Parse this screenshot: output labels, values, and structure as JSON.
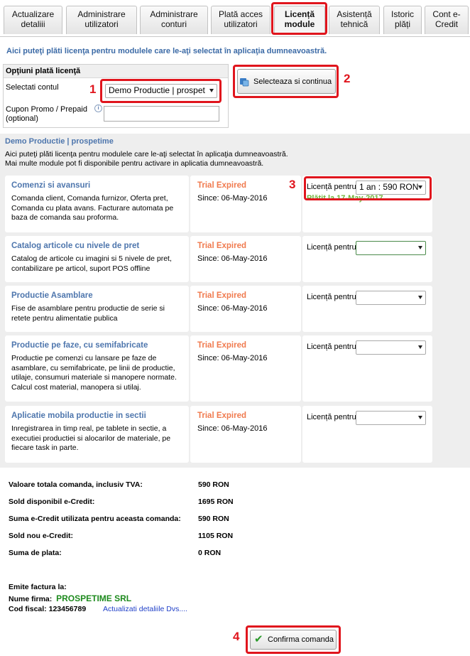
{
  "tabs": [
    {
      "label": "Actualizare detaliii",
      "active": false
    },
    {
      "label": "Administrare utilizatori",
      "active": false
    },
    {
      "label": "Administrare conturi",
      "active": false
    },
    {
      "label": "Plată acces utilizatori",
      "active": false
    },
    {
      "label": "Licență module",
      "active": true
    },
    {
      "label": "Asistență tehnică",
      "active": false
    },
    {
      "label": "Istoric plăți",
      "active": false
    },
    {
      "label": "Cont e-Credit",
      "active": false
    }
  ],
  "intro": "Aici puteţi plăti licenţa pentru modulele care le-aţi selectat în aplicaţia dumneavoastră.",
  "options": {
    "title": "Opţiuni plată licenţă",
    "account_label": "Selectati contul",
    "account_value": "Demo Productie | prospet",
    "coupon_label": "Cupon Promo / Prepaid (optional)",
    "coupon_value": "",
    "select_button": "Selecteaza si continua"
  },
  "steps": [
    "1",
    "2",
    "3",
    "4"
  ],
  "account_section": {
    "title": "Demo Productie | prospetime",
    "desc1": "Aici puteţi plăti licenţa pentru modulele care le-aţi selectat în aplicaţia dumneavoastră.",
    "desc2": "Mai multe module pot fi disponibile pentru activare in aplicatia dumneavoastră."
  },
  "modules": [
    {
      "title": "Comenzi si avansuri",
      "desc": "Comanda client, Comanda furnizor, Oferta pret, Comanda cu plata avans. Facturare automata pe baza de comanda sau proforma.",
      "status": "Trial Expired",
      "since": "Since: 06-May-2016",
      "license_label": "Licență pentru",
      "license_value": "1 an : 590 RON",
      "paid_until": "Plătit la 17-May-2017"
    },
    {
      "title": "Catalog articole cu nivele de pret",
      "desc": "Catalog de articole cu imagini si 5 nivele de pret, contabilizare pe articol, suport POS offline",
      "status": "Trial Expired",
      "since": "Since: 06-May-2016",
      "license_label": "Licență pentru",
      "license_value": "",
      "paid_until": ""
    },
    {
      "title": "Productie Asamblare",
      "desc": "Fise de asamblare pentru productie de serie si retete pentru alimentatie publica",
      "status": "Trial Expired",
      "since": "Since: 06-May-2016",
      "license_label": "Licență pentru",
      "license_value": "",
      "paid_until": ""
    },
    {
      "title": "Productie pe faze, cu semifabricate",
      "desc": "Productie pe comenzi cu lansare pe faze de asamblare, cu semifabricate, pe linii de productie, utilaje, consumuri materiale si manopere normate. Calcul cost material, manopera si utilaj.",
      "status": "Trial Expired",
      "since": "Since: 06-May-2016",
      "license_label": "Licență pentru",
      "license_value": "",
      "paid_until": ""
    },
    {
      "title": "Aplicatie mobila productie in sectii",
      "desc": "Inregistrarea in timp real, pe tablete in sectie, a executiei productiei si alocarilor de materiale, pe fiecare task in parte.",
      "status": "Trial Expired",
      "since": "Since: 06-May-2016",
      "license_label": "Licență pentru",
      "license_value": "",
      "paid_until": ""
    }
  ],
  "summary": [
    {
      "label": "Valoare totala comanda, inclusiv TVA:",
      "value": "590 RON"
    },
    {
      "label": "Sold disponibil e-Credit:",
      "value": "1695 RON"
    },
    {
      "label": "Suma e-Credit utilizata pentru aceasta comanda:",
      "value": "590 RON"
    },
    {
      "label": "Sold nou e-Credit:",
      "value": "1105 RON"
    },
    {
      "label": "Suma de plata:",
      "value": "0 RON"
    }
  ],
  "invoice": {
    "title": "Emite factura la:",
    "firm_label": "Nume firma:",
    "firm_value": "PROSPETIME SRL",
    "fiscal_label": "Cod fiscal:",
    "fiscal_value": "123456789",
    "update_link": "Actualizati detaliile Dvs...."
  },
  "confirm_button": "Confirma comanda",
  "colors": {
    "accent_red": "#e0151d",
    "title_blue": "#4e76ad",
    "trial_orange": "#f07a4e",
    "paid_green": "#72b23b",
    "firm_green": "#1d8a1d"
  }
}
